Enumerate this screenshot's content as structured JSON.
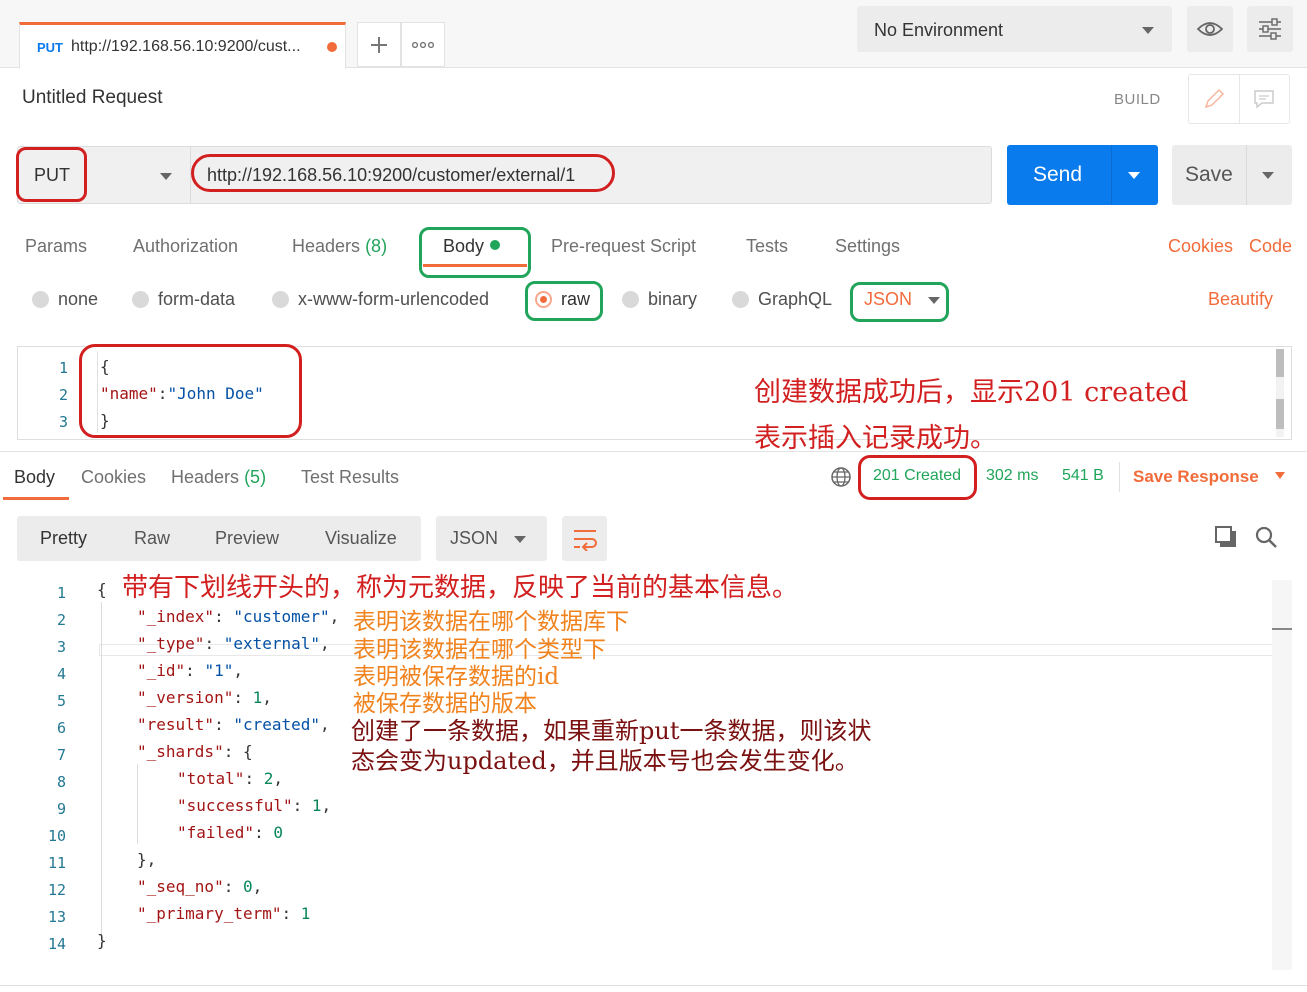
{
  "tab": {
    "method": "PUT",
    "url": "http://192.168.56.10:9200/cust..."
  },
  "environment": {
    "selected": "No Environment"
  },
  "request": {
    "title": "Untitled Request",
    "build_label": "BUILD",
    "method": "PUT",
    "url": "http://192.168.56.10:9200/customer/external/1",
    "send_label": "Send",
    "save_label": "Save"
  },
  "request_tabs": {
    "params": "Params",
    "authorization": "Authorization",
    "headers": "Headers",
    "headers_count": "(8)",
    "body": "Body",
    "prerequest": "Pre-request Script",
    "tests": "Tests",
    "settings": "Settings",
    "cookies": "Cookies",
    "code": "Code"
  },
  "body_types": {
    "none": "none",
    "form_data": "form-data",
    "urlencoded": "x-www-form-urlencoded",
    "raw": "raw",
    "binary": "binary",
    "graphql": "GraphQL",
    "format": "JSON",
    "beautify": "Beautify"
  },
  "request_body": {
    "line_numbers": [
      "1",
      "2",
      "3"
    ],
    "line1": "{",
    "key": "\"name\"",
    "colon": ":",
    "value": "\"John Doe\"",
    "line3": "}"
  },
  "annotation_request": {
    "line1": "创建数据成功后，显示201 created",
    "line2": "表示插入记录成功。"
  },
  "response_tabs": {
    "body": "Body",
    "cookies": "Cookies",
    "headers": "Headers",
    "headers_count": "(5)",
    "test_results": "Test Results"
  },
  "response_status": {
    "status": "201 Created",
    "time": "302 ms",
    "size": "541 B",
    "save_response": "Save Response"
  },
  "response_view": {
    "pretty": "Pretty",
    "raw": "Raw",
    "preview": "Preview",
    "visualize": "Visualize",
    "format": "JSON"
  },
  "response_body": {
    "line_numbers": [
      "1",
      "2",
      "3",
      "4",
      "5",
      "6",
      "7",
      "8",
      "9",
      "10",
      "11",
      "12",
      "13",
      "14"
    ],
    "lines": [
      [
        {
          "t": "p",
          "v": "{"
        }
      ],
      [
        {
          "t": "k",
          "v": "\"_index\""
        },
        {
          "t": "p",
          "v": ": "
        },
        {
          "t": "s",
          "v": "\"customer\""
        },
        {
          "t": "p",
          "v": ","
        }
      ],
      [
        {
          "t": "k",
          "v": "\"_type\""
        },
        {
          "t": "p",
          "v": ": "
        },
        {
          "t": "s",
          "v": "\"external\""
        },
        {
          "t": "p",
          "v": ","
        }
      ],
      [
        {
          "t": "k",
          "v": "\"_id\""
        },
        {
          "t": "p",
          "v": ": "
        },
        {
          "t": "s",
          "v": "\"1\""
        },
        {
          "t": "p",
          "v": ","
        }
      ],
      [
        {
          "t": "k",
          "v": "\"_version\""
        },
        {
          "t": "p",
          "v": ": "
        },
        {
          "t": "n",
          "v": "1"
        },
        {
          "t": "p",
          "v": ","
        }
      ],
      [
        {
          "t": "k",
          "v": "\"result\""
        },
        {
          "t": "p",
          "v": ": "
        },
        {
          "t": "s",
          "v": "\"created\""
        },
        {
          "t": "p",
          "v": ","
        }
      ],
      [
        {
          "t": "k",
          "v": "\"_shards\""
        },
        {
          "t": "p",
          "v": ": {"
        }
      ],
      [
        {
          "t": "k",
          "v": "\"total\""
        },
        {
          "t": "p",
          "v": ": "
        },
        {
          "t": "n",
          "v": "2"
        },
        {
          "t": "p",
          "v": ","
        }
      ],
      [
        {
          "t": "k",
          "v": "\"successful\""
        },
        {
          "t": "p",
          "v": ": "
        },
        {
          "t": "n",
          "v": "1"
        },
        {
          "t": "p",
          "v": ","
        }
      ],
      [
        {
          "t": "k",
          "v": "\"failed\""
        },
        {
          "t": "p",
          "v": ": "
        },
        {
          "t": "n",
          "v": "0"
        }
      ],
      [
        {
          "t": "p",
          "v": "},"
        }
      ],
      [
        {
          "t": "k",
          "v": "\"_seq_no\""
        },
        {
          "t": "p",
          "v": ": "
        },
        {
          "t": "n",
          "v": "0"
        },
        {
          "t": "p",
          "v": ","
        }
      ],
      [
        {
          "t": "k",
          "v": "\"_primary_term\""
        },
        {
          "t": "p",
          "v": ": "
        },
        {
          "t": "n",
          "v": "1"
        }
      ],
      [
        {
          "t": "p",
          "v": "}"
        }
      ]
    ]
  },
  "annotations_response": {
    "metadata": "带有下划线开头的，称为元数据，反映了当前的基本信息。",
    "index": "表明该数据在哪个数据库下",
    "type": "表明该数据在哪个类型下",
    "id": "表明被保存数据的id",
    "version": "被保存数据的版本",
    "result_line1": "创建了一条数据，如果重新put一条数据，则该状",
    "result_line2": "态会变为updated，并且版本号也会发生变化。"
  },
  "colors": {
    "accent": "#f26b3a",
    "send": "#097bed",
    "status_ok": "#21a55a",
    "highlight_red": "#d21f1f",
    "highlight_green": "#21a55a"
  }
}
